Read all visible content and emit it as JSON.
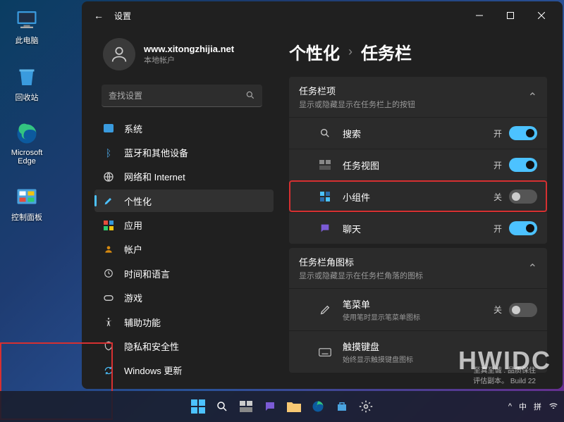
{
  "desktop": {
    "this_pc": "此电脑",
    "recycle_bin": "回收站",
    "edge": "Microsoft Edge",
    "control_panel": "控制面板"
  },
  "window": {
    "title": "设置"
  },
  "user": {
    "name": "www.xitongzhijia.net",
    "sub": "本地帐户"
  },
  "search": {
    "placeholder": "查找设置"
  },
  "nav": {
    "system": "系统",
    "bluetooth": "蓝牙和其他设备",
    "network": "网络和 Internet",
    "personalization": "个性化",
    "apps": "应用",
    "accounts": "帐户",
    "time": "时间和语言",
    "gaming": "游戏",
    "accessibility": "辅助功能",
    "privacy": "隐私和安全性",
    "update": "Windows 更新"
  },
  "breadcrumb": {
    "parent": "个性化",
    "sep": "›",
    "current": "任务栏"
  },
  "section1": {
    "title": "任务栏项",
    "subtitle": "显示或隐藏显示在任务栏上的按钮",
    "on": "开",
    "off": "关",
    "search": "搜索",
    "taskview": "任务视图",
    "widgets": "小组件",
    "chat": "聊天"
  },
  "section2": {
    "title": "任务栏角图标",
    "subtitle": "显示或隐藏显示在任务栏角落的图标",
    "pen_title": "笔菜单",
    "pen_sub": "使用笔时显示笔菜单图标",
    "touch_title": "触摸键盘",
    "touch_sub": "始终显示触摸键盘图标",
    "off": "关"
  },
  "footer": {
    "line1": "至真至诚 . 品质保住",
    "line2": "评估副本。 Build 22"
  },
  "watermark": "HWIDC",
  "tray": {
    "chevron": "^",
    "ime1": "中",
    "ime2": "拼"
  }
}
